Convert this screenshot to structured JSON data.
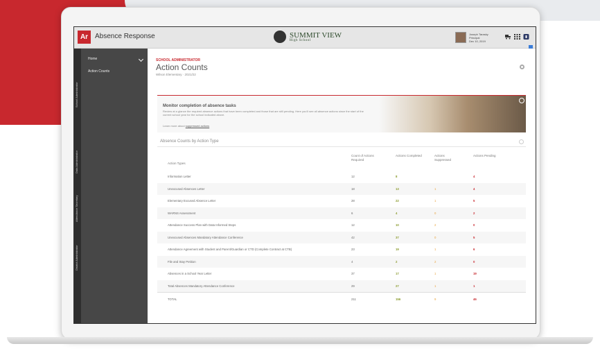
{
  "app": {
    "logo": "Ar",
    "title": "Absence Response"
  },
  "school": {
    "name": "SUMMIT VIEW",
    "subtitle": "High School"
  },
  "user": {
    "name": "Joseph Tarasky",
    "role": "Principal",
    "date": "Dec 10, 2019"
  },
  "sidebar": {
    "vertical_tabs": [
      "School Administrator",
      "Data Administrator",
      "Attendance Secretary",
      "District Administrator"
    ],
    "items": [
      {
        "label": "Home"
      },
      {
        "label": "Action Counts"
      }
    ]
  },
  "page": {
    "role": "SCHOOL ADMINISTRATOR",
    "title": "Action Counts",
    "subtitle": "Wilson Elementary · 2021/22"
  },
  "banner": {
    "title": "Monitor completion of absence tasks",
    "text": "Review at a glance the required absence actions that have been completed and those that are still pending. Here you'll see all absence actions since the start of the current school year for the school indicated above.",
    "link_prefix": "Learn more about",
    "link_text": "suppressed actions"
  },
  "section": {
    "title": "Absence Counts by Action Type"
  },
  "table": {
    "headers": {
      "type": "Action Types",
      "required": "Count of Actions Required",
      "completed": "Actions Completed",
      "suppressed": "Actions Suppressed",
      "pending": "Actions Pending"
    },
    "rows": [
      {
        "type": "Information Letter",
        "required": "12",
        "completed": "8",
        "suppressed": "",
        "pending": "4"
      },
      {
        "type": "Unexcused Absences Letter",
        "required": "18",
        "completed": "13",
        "suppressed": "1",
        "pending": "4"
      },
      {
        "type": "Elementary Excused Absence Letter",
        "required": "28",
        "completed": "22",
        "suppressed": "1",
        "pending": "5"
      },
      {
        "type": "WARNS Assessment",
        "required": "6",
        "completed": "4",
        "suppressed": "0",
        "pending": "2"
      },
      {
        "type": "Attendance Success Plan with Data Informed Steps",
        "required": "12",
        "completed": "10",
        "suppressed": "2",
        "pending": "0"
      },
      {
        "type": "Unexcused Absences Mandatory Attendance Conference",
        "required": "42",
        "completed": "37",
        "suppressed": "0",
        "pending": "5"
      },
      {
        "type": "Attendance Agreement with Student and Parent/Guardian or CTD (Complete Contract at CTB)",
        "required": "23",
        "completed": "19",
        "suppressed": "1",
        "pending": "6"
      },
      {
        "type": "File and Stay Petition",
        "required": "4",
        "completed": "2",
        "suppressed": "2",
        "pending": "0"
      },
      {
        "type": "Absences in a School Year Letter",
        "required": "37",
        "completed": "17",
        "suppressed": "1",
        "pending": "19"
      },
      {
        "type": "Total Absences Mandatory Attendance Conference",
        "required": "29",
        "completed": "27",
        "suppressed": "1",
        "pending": "1"
      }
    ],
    "total": {
      "label": "TOTAL",
      "required": "211",
      "completed": "156",
      "suppressed": "9",
      "pending": "46"
    }
  },
  "colors": {
    "brand_red": "#c8282e",
    "sidebar": "#474747",
    "completed": "#8a9a2c",
    "suppressed": "#e9a23b"
  }
}
